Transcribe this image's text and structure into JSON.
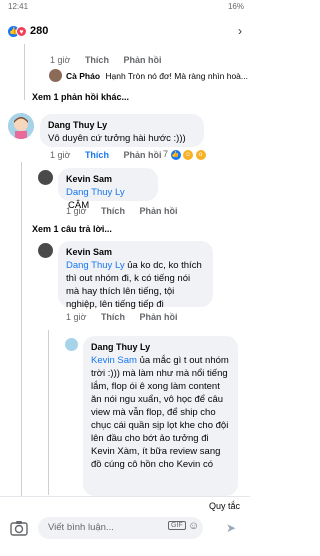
{
  "status": {
    "time": "12:41",
    "battery": "16%"
  },
  "reactions": {
    "count": "280"
  },
  "actions": {
    "like": "Thích",
    "reply": "Phản hồi"
  },
  "comments": {
    "c0": {
      "time": "1 giờ"
    },
    "c1": {
      "name": "Cà Pháo",
      "text": "Hạnh Tròn nó đơ! Mà ràng nhìn hoà...",
      "time": "1 giờ",
      "view_replies": "Xem 1 phản hồi khác..."
    },
    "c2": {
      "name": "Dang Thuy Ly",
      "text": "Vô duyên cứ tưởng hài hước :)))",
      "time": "1 giờ",
      "reacts": "7"
    },
    "c3": {
      "name": "Kevin Sam",
      "mention": "Dang Thuy Ly",
      "text": "CÂM",
      "time": "1 giờ",
      "view_replies": "Xem 1 câu trả lời..."
    },
    "c4": {
      "name": "Kevin Sam",
      "mention": "Dang Thuy Ly",
      "text": " ủa ko dc, ko thích thì out nhóm đi, k có tiếng nói mà hay thích lên tiếng, tội nghiệp, lên tiếng tiếp đi",
      "time": "1 giờ"
    },
    "c5": {
      "name": "Dang Thuy Ly",
      "mention": "Kevin Sam",
      "text": " ủa mắc gì t out nhóm trời :))) mà làm như mà nổi tiếng lắm, flop ói ê xong làm content ăn nói ngu xuẩn, vô học để câu view mà vẫn flop, để ship cho chục cái quần sịp lọt khe cho đội lên đầu cho bớt ảo tưởng đi Kevin Xàm, ít bữa review sang đồ cúng cô hồn cho Kevin có"
    }
  },
  "composer": {
    "post_anonymously": "Quy tắc",
    "placeholder": "Viết bình luận...",
    "gif": "GIF"
  }
}
